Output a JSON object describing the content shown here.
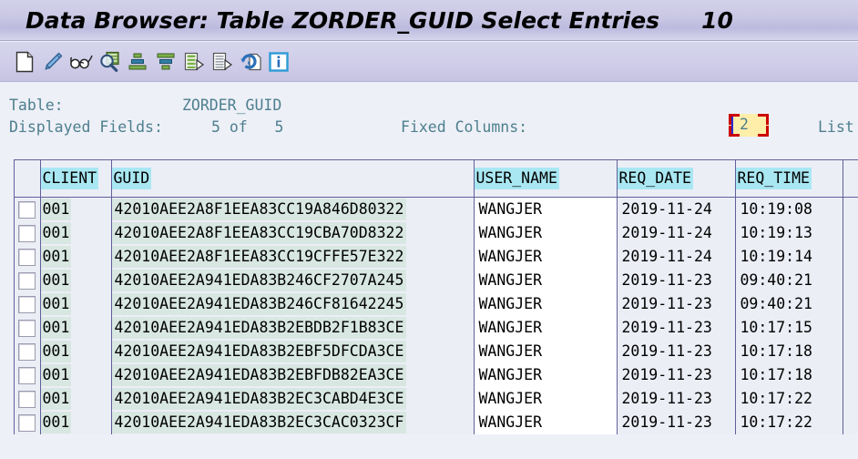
{
  "window": {
    "title": "Data Browser: Table ZORDER_GUID Select Entries",
    "entry_count": "10"
  },
  "toolbar": {
    "buttons": [
      {
        "name": "new-document-icon",
        "label": "Create"
      },
      {
        "name": "pencil-edit-icon",
        "label": "Change"
      },
      {
        "name": "glasses-display-icon",
        "label": "Display"
      },
      {
        "name": "magnifier-check-icon",
        "label": "Check Table"
      },
      {
        "name": "sort-ascending-icon",
        "label": "Sort in Ascending Order"
      },
      {
        "name": "sort-descending-icon",
        "label": "Sort in Descending Order"
      },
      {
        "name": "set-filter-icon",
        "label": "Set Filter"
      },
      {
        "name": "delete-filter-icon",
        "label": "Delete Filter"
      },
      {
        "name": "refresh-icon",
        "label": "Refresh"
      },
      {
        "name": "info-icon",
        "label": "Details"
      }
    ]
  },
  "info": {
    "table_label": "Table:",
    "table_value": "ZORDER_GUID",
    "fields_label": "Displayed Fields:",
    "fields_value": "5 of   5",
    "fixed_columns_label": "Fixed Columns:",
    "fixed_columns_value": "2",
    "list_label": "List"
  },
  "grid": {
    "columns": [
      {
        "key": "check",
        "label": ""
      },
      {
        "key": "client",
        "label": "CLIENT"
      },
      {
        "key": "guid",
        "label": "GUID"
      },
      {
        "key": "user",
        "label": "USER_NAME"
      },
      {
        "key": "date",
        "label": "REQ_DATE"
      },
      {
        "key": "time",
        "label": "REQ_TIME"
      }
    ],
    "rows": [
      {
        "client": "001",
        "guid": "42010AEE2A8F1EEA83CC19A846D80322",
        "user": "WANGJER",
        "date": "2019-11-24",
        "time": "10:19:08"
      },
      {
        "client": "001",
        "guid": "42010AEE2A8F1EEA83CC19CBA70D8322",
        "user": "WANGJER",
        "date": "2019-11-24",
        "time": "10:19:13"
      },
      {
        "client": "001",
        "guid": "42010AEE2A8F1EEA83CC19CFFE57E322",
        "user": "WANGJER",
        "date": "2019-11-24",
        "time": "10:19:14"
      },
      {
        "client": "001",
        "guid": "42010AEE2A941EDA83B246CF2707A245",
        "user": "WANGJER",
        "date": "2019-11-23",
        "time": "09:40:21"
      },
      {
        "client": "001",
        "guid": "42010AEE2A941EDA83B246CF81642245",
        "user": "WANGJER",
        "date": "2019-11-23",
        "time": "09:40:21"
      },
      {
        "client": "001",
        "guid": "42010AEE2A941EDA83B2EBDB2F1B83CE",
        "user": "WANGJER",
        "date": "2019-11-23",
        "time": "10:17:15"
      },
      {
        "client": "001",
        "guid": "42010AEE2A941EDA83B2EBF5DFCDA3CE",
        "user": "WANGJER",
        "date": "2019-11-23",
        "time": "10:17:18"
      },
      {
        "client": "001",
        "guid": "42010AEE2A941EDA83B2EBFDB82EA3CE",
        "user": "WANGJER",
        "date": "2019-11-23",
        "time": "10:17:18"
      },
      {
        "client": "001",
        "guid": "42010AEE2A941EDA83B2EC3CABD4E3CE",
        "user": "WANGJER",
        "date": "2019-11-23",
        "time": "10:17:22"
      },
      {
        "client": "001",
        "guid": "42010AEE2A941EDA83B2EC3CAC0323CF",
        "user": "WANGJER",
        "date": "2019-11-23",
        "time": "10:17:22"
      }
    ]
  },
  "colors": {
    "titlebar": "#c9c7e4",
    "header_cell": "#a9e7f2",
    "key_cell": "#d8e7e1",
    "info_text": "#4d7f8e",
    "focus_border": "#cc0000",
    "focus_field": "#ffeeaa"
  }
}
